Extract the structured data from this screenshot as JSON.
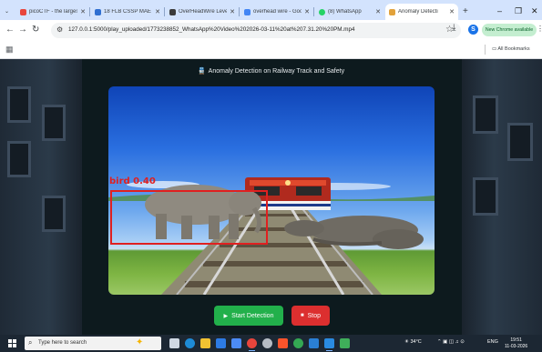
{
  "browser": {
    "tab_menu_icon": "chevron-down-icon",
    "tabs": [
      {
        "label": "picoCTF - the largest",
        "favicon_color": "#e8453c",
        "active": false
      },
      {
        "label": "18 FLB CSSP MAE - U",
        "favicon_color": "#2f6fd1",
        "active": false
      },
      {
        "label": "OverHeadWire Level I",
        "favicon_color": "#3a3a3a",
        "active": false
      },
      {
        "label": "overhead wire - Google",
        "favicon_color": "#4285f4",
        "active": false
      },
      {
        "label": "(8) WhatsApp",
        "favicon_color": "#25d366",
        "active": false
      },
      {
        "label": "Anomaly Detecti",
        "favicon_color": "#e2a23b",
        "active": true
      }
    ],
    "new_tab_label": "+",
    "url": "127.0.0.1:5000/play_uploaded/1773238852_WhatsApp%20Video%202026-03-11%20at%207.31.20%20PM.mp4",
    "chrome_available_label": "New Chrome available",
    "profile_initial": "S",
    "all_bookmarks_label": "All Bookmarks",
    "window_controls": [
      "–",
      "❐",
      "✕"
    ]
  },
  "page": {
    "heading": "Anomaly Detection on Railway Track and Safety",
    "heading_icon": "train-icon",
    "detection": {
      "label": "bird 0.40",
      "color": "#e02020"
    },
    "start_button": "Start Detection",
    "stop_button": "Stop",
    "colors": {
      "start": "#22b04b",
      "stop": "#dc2f2f",
      "panel": "#0d1a1e"
    }
  },
  "taskbar": {
    "search_placeholder": "Type here to search",
    "apps": [
      {
        "name": "task-view",
        "color": "#cfd8e3"
      },
      {
        "name": "edge",
        "color": "#1e8bd6"
      },
      {
        "name": "explorer",
        "color": "#f1c232"
      },
      {
        "name": "store",
        "color": "#2d7be5"
      },
      {
        "name": "calendar",
        "color": "#4c8bf5"
      },
      {
        "name": "chrome",
        "color": "#e8453c"
      },
      {
        "name": "settings",
        "color": "#b5bcc5"
      },
      {
        "name": "brave",
        "color": "#fb542b"
      },
      {
        "name": "chrome-dev",
        "color": "#34a853"
      },
      {
        "name": "photos",
        "color": "#2a7fd4"
      },
      {
        "name": "vscode",
        "color": "#2a8be0"
      },
      {
        "name": "app-green",
        "color": "#3fae5a"
      }
    ],
    "weather": "34°C",
    "language": "ENG",
    "time": "19:51",
    "date": "11-03-2026"
  }
}
